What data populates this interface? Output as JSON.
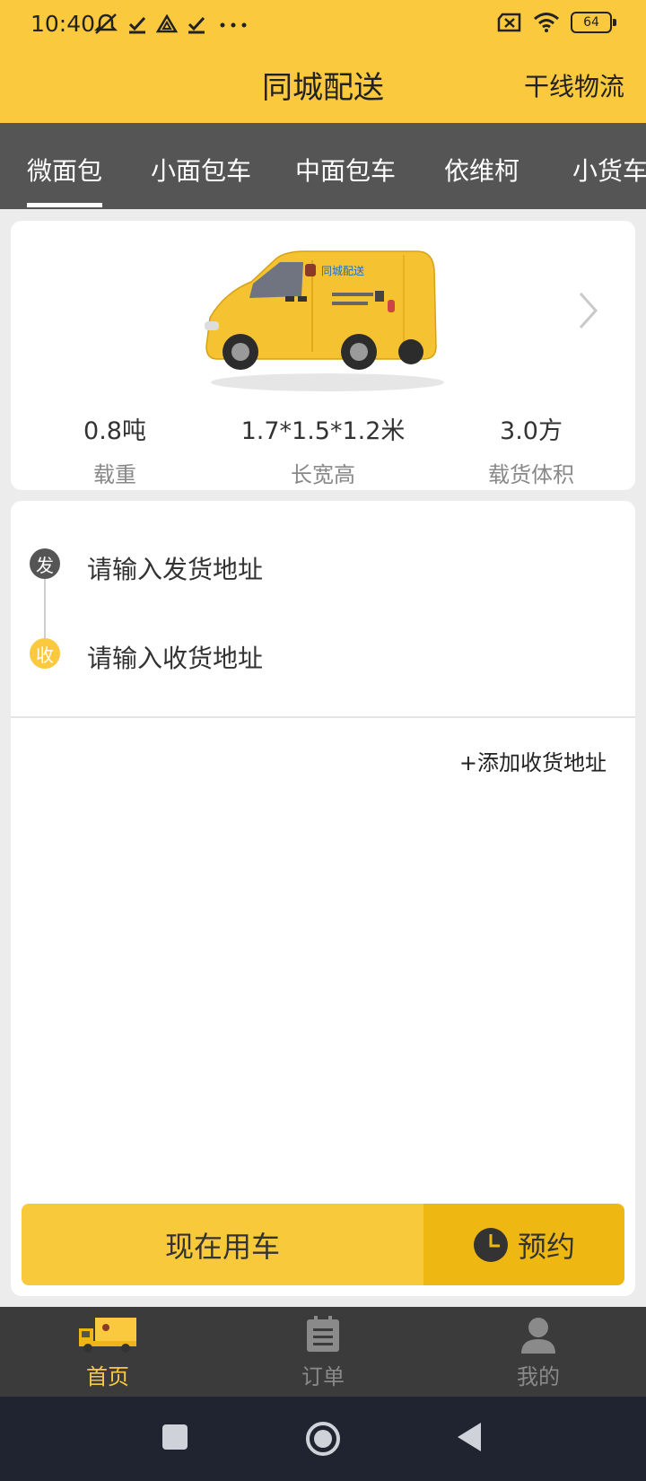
{
  "status_bar": {
    "time": "10:40",
    "battery": "64",
    "icons": [
      "mute-icon",
      "check-icon",
      "drive-icon",
      "check-icon",
      "more-dots-icon",
      "sim-off-icon",
      "wifi-icon",
      "battery-icon"
    ]
  },
  "header": {
    "title": "同城配送",
    "right_link": "干线物流"
  },
  "tabs": {
    "items": [
      "微面包",
      "小面包车",
      "中面包车",
      "依维柯",
      "小货车"
    ],
    "selected": "微面包"
  },
  "vehicle": {
    "brand_text": "同城配送",
    "specs": [
      {
        "value": "0.8吨",
        "label": "载重"
      },
      {
        "value": "1.7*1.5*1.2米",
        "label": "长宽高"
      },
      {
        "value": "3.0方",
        "label": "载货体积"
      }
    ]
  },
  "address": {
    "send_badge": "发",
    "recv_badge": "收",
    "send_placeholder": "请输入发货地址",
    "recv_placeholder": "请输入收货地址",
    "add_link": "+添加收货地址"
  },
  "actions": {
    "now": "现在用车",
    "book": "预约"
  },
  "bottom_nav": {
    "items": [
      {
        "label": "首页",
        "icon": "truck-icon",
        "active": true
      },
      {
        "label": "订单",
        "icon": "clipboard-icon",
        "active": false
      },
      {
        "label": "我的",
        "icon": "user-icon",
        "active": false
      }
    ]
  },
  "colors": {
    "brand_yellow": "#fbc93d",
    "tab_bar": "#555555",
    "book_button": "#eeb712",
    "nav_active": "#fbc93d",
    "nav_inactive": "#8a8a8a"
  }
}
